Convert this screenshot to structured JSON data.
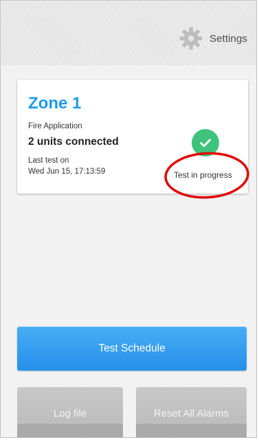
{
  "header": {
    "settings_label": "Settings",
    "settings_icon": "gear-icon"
  },
  "zone_card": {
    "zone_name": "Zone 1",
    "application": "Fire Application",
    "units": "2 units connected",
    "last_test_label": "Last test on",
    "last_test_value": "Wed Jun 15, 17:13:59",
    "status_icon": "check-circle-icon",
    "status_text": "Test in progress",
    "status_color": "#3fc27a",
    "zone_color": "#1e9be9"
  },
  "annotation": {
    "highlight_color": "#e00000"
  },
  "actions": {
    "test_schedule_label": "Test Schedule",
    "log_file_label": "Log file",
    "reset_all_label": "Reset All Alarms",
    "primary_color": "#2b95ee"
  }
}
